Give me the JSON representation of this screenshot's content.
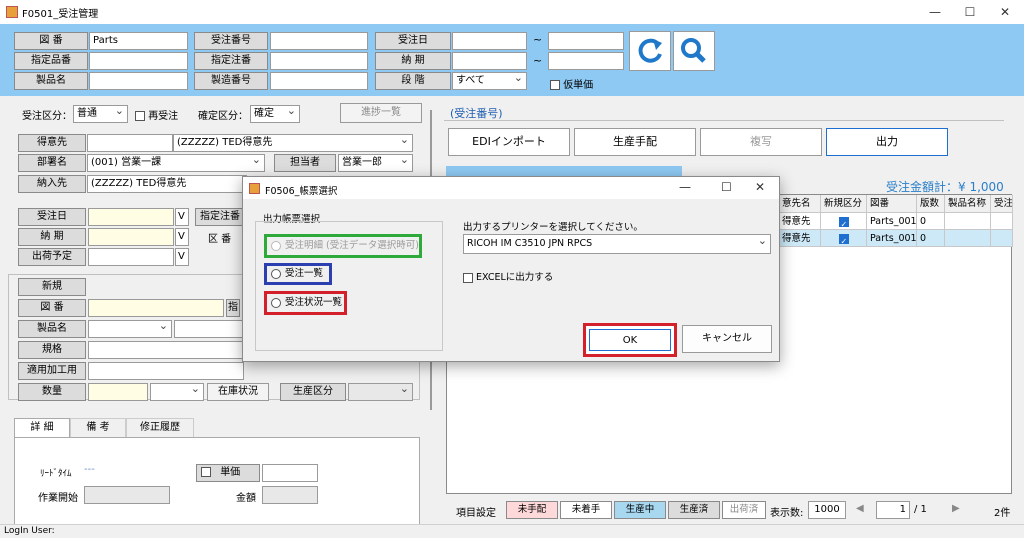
{
  "window": {
    "title": "F0501_受注管理"
  },
  "header": {
    "labels": [
      "図 番",
      "指定品番",
      "製品名",
      "受注番号",
      "指定注番",
      "製造番号",
      "受注日",
      "納 期",
      "段 階"
    ],
    "zuban_value": "Parts",
    "dankai_value": "すべて",
    "range_sep": "~",
    "kari_tanka": "仮単価"
  },
  "left": {
    "juchu_kubun_label": "受注区分：",
    "juchu_kubun_value": "普通",
    "sai_juchu": "再受注",
    "kakutei_kubun_label": "確定区分：",
    "kakutei_kubun_value": "確定",
    "shinchoku_btn": "進捗一覧",
    "tokuisaki_label": "得意先",
    "tokuisaki_value": "(ZZZZZ) TED得意先",
    "busho_label": "部署名",
    "busho_value": "(001) 営業一課",
    "tantou_label": "担当者",
    "tantou_value": "営業一郎",
    "nounyu_label": "納入先",
    "nounyu_value": "(ZZZZZ) TED得意先",
    "juchubi_label": "受注日",
    "nouki_label": "納 期",
    "shukka_label": "出荷予定",
    "v": "V",
    "shitei_chuban": "指定注番",
    "kuban": "区 番",
    "shinki": "新規",
    "zuban": "図 番",
    "shi": "指",
    "seihinmei": "製品名",
    "kikaku": "規格",
    "tekiyou": "適用加工用",
    "suuryou": "数量",
    "zaiko_btn": "在庫状況",
    "seisan_kubun": "生産区分",
    "tabs": [
      "詳 細",
      "備 考",
      "修正履歴"
    ],
    "lead_time": "ﾘｰﾄﾞﾀｲﾑ",
    "lead_time_val": "---",
    "tanka": "単価",
    "sagyou_kaishi": "作業開始",
    "kingaku": "金額"
  },
  "right": {
    "juchu_bangou": "(受注番号)",
    "buttons": [
      "EDIインポート",
      "生産手配",
      "複写",
      "出力"
    ],
    "total": "受注金額計：¥ 1,000",
    "columns": [
      "意先名",
      "新規区分",
      "図番",
      "版数",
      "製品名称",
      "受注"
    ],
    "rows": [
      {
        "c0": "得意先",
        "c2": "Parts_001",
        "c3": "0"
      },
      {
        "c0": "得意先",
        "c2": "Parts_001",
        "c3": "0"
      }
    ]
  },
  "status": {
    "koumoku": "項目設定",
    "states": [
      "未手配",
      "未着手",
      "生産中",
      "生産済",
      "出荷済"
    ],
    "state_colors": [
      "#ffd9d9",
      "#ffffff",
      "#a8d8f0",
      "#dcdcdc",
      "#ffffff"
    ],
    "hyouji_label": "表示数:",
    "hyouji_value": "1000",
    "page": "1",
    "page_total": "/ 1",
    "count": "2件",
    "login": "LogIn User:"
  },
  "dialog": {
    "title": "F0506_帳票選択",
    "group_label": "出力帳票選択",
    "options": [
      "受注明細 (受注データ選択時可)",
      "受注一覧",
      "受注状況一覧"
    ],
    "printer_prompt": "出力するプリンターを選択してください。",
    "printer_value": "RICOH IM C3510 JPN RPCS",
    "excel": "EXCELに出力する",
    "ok": "OK",
    "cancel": "キャンセル",
    "highlight_colors": [
      "#2eaa3a",
      "#2b3fb0",
      "#d4202a",
      "#d4202a"
    ]
  }
}
